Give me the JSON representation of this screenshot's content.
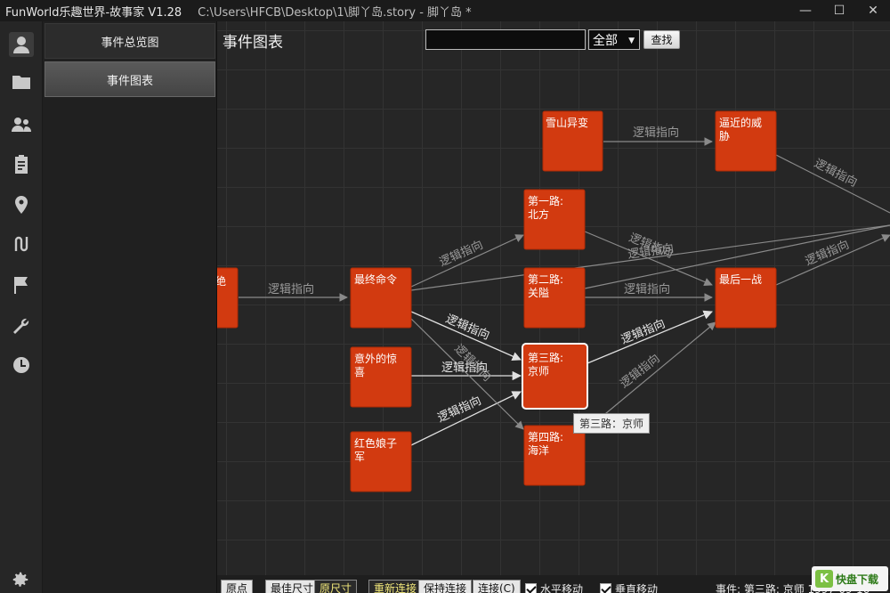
{
  "window": {
    "app_title": "FunWorld乐趣世界-故事家 V1.28",
    "doc_path": "C:\\Users\\HFCB\\Desktop\\1\\脚丫岛.story - 脚丫岛 *",
    "minimize": "—",
    "maximize": "☐",
    "close": "✕"
  },
  "rail": {
    "icons": [
      "user-icon",
      "folder-icon",
      "people-icon",
      "clipboard-icon",
      "location-pin-icon",
      "route-icon",
      "flag-icon",
      "wrench-icon",
      "clock-icon",
      "gear-icon"
    ]
  },
  "sidenav": {
    "items": [
      {
        "label": "事件总览图"
      },
      {
        "label": "事件图表"
      }
    ]
  },
  "main": {
    "title": "事件图表",
    "search_value": "",
    "filter_selected": "全部",
    "search_button": "查找"
  },
  "graph": {
    "nodes": [
      {
        "id": "n0",
        "line1": "绝",
        "line2": ""
      },
      {
        "id": "n1",
        "line1": "最终命令",
        "line2": ""
      },
      {
        "id": "n2",
        "line1": "意外的惊",
        "line2": "喜"
      },
      {
        "id": "n3",
        "line1": "红色娘子",
        "line2": "军"
      },
      {
        "id": "n4",
        "line1": "雪山异变",
        "line2": ""
      },
      {
        "id": "n5",
        "line1": "第一路:",
        "line2": "北方"
      },
      {
        "id": "n6",
        "line1": "第二路:",
        "line2": "关隘"
      },
      {
        "id": "n7",
        "line1": "第三路:",
        "line2": "京师"
      },
      {
        "id": "n8",
        "line1": "第四路:",
        "line2": "海洋"
      },
      {
        "id": "n9",
        "line1": "逼近的威",
        "line2": "胁"
      },
      {
        "id": "n10",
        "line1": "最后一战",
        "line2": ""
      }
    ],
    "edge_label": "逻辑指向",
    "tooltip": "第三路：京师"
  },
  "bottombar": {
    "origin": "原点",
    "fit_size": "最佳尺寸",
    "original_size": "原尺寸",
    "relink": "重新连接",
    "keep_link": "保持连接",
    "link": "连接(C)",
    "horizontal_move": "水平移动",
    "vertical_move": "垂直移动",
    "status": "事件: 第三路: 京师  1997-09-16"
  },
  "watermark": {
    "mark": "K",
    "text": "快盘下载"
  },
  "colors": {
    "node_fill": "#d23a10",
    "node_border": "#b02a05",
    "selected_border": "#ffffff",
    "edge": "#8a8a8a"
  }
}
